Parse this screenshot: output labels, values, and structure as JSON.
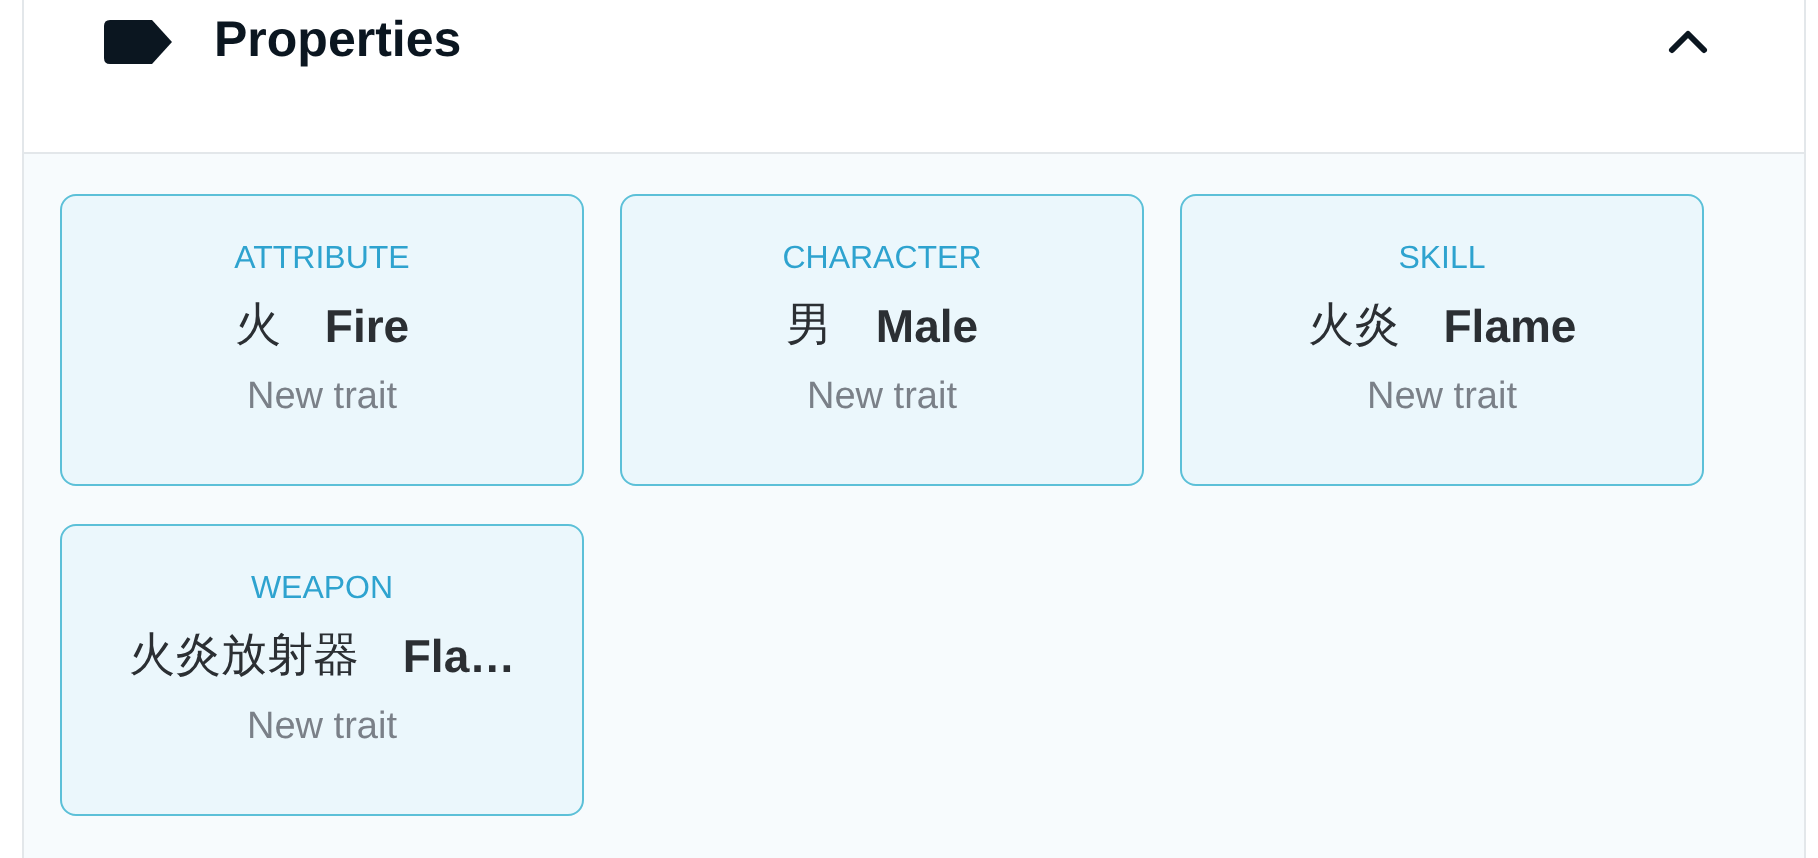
{
  "panel": {
    "title": "Properties",
    "expanded": true
  },
  "cards": [
    {
      "label": "ATTRIBUTE",
      "native": "火",
      "value": "Fire",
      "note": "New trait"
    },
    {
      "label": "CHARACTER",
      "native": "男",
      "value": "Male",
      "note": "New trait"
    },
    {
      "label": "SKILL",
      "native": "火炎",
      "value": "Flame",
      "note": "New trait"
    },
    {
      "label": "WEAPON",
      "native": "火炎放射器",
      "value": "Fla…",
      "note": "New trait"
    }
  ]
}
